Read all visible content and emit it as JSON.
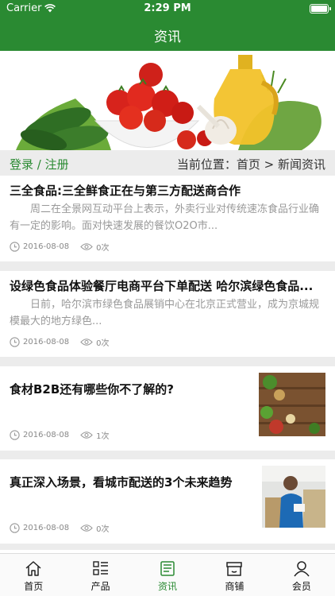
{
  "status_bar": {
    "carrier": "Carrier",
    "time": "2:29 PM"
  },
  "nav": {
    "title": "资讯"
  },
  "auth": {
    "login": "登录",
    "slash": " / ",
    "register": "注册"
  },
  "breadcrumb": {
    "prefix": "当前位置：",
    "home": "首页",
    "sep": " > ",
    "current": "新闻资讯"
  },
  "articles": [
    {
      "title": "三全食品:三全鲜食正在与第三方配送商合作",
      "summary": "周二在全景网互动平台上表示，外卖行业对传统速冻食品行业确有一定的影响。面对快速发展的餐饮O2O市...",
      "date": "2016-08-08",
      "views": "0次"
    },
    {
      "title": "设绿色食品体验餐厅电商平台下单配送 哈尔滨绿色食品...",
      "summary": "日前，哈尔滨市绿色食品展销中心在北京正式营业，成为京城规模最大的地方绿色...",
      "date": "2016-08-08",
      "views": "0次"
    },
    {
      "title": "食材B2B还有哪些你不了解的?",
      "date": "2016-08-08",
      "views": "1次"
    },
    {
      "title": "真正深入场景，看城市配送的3个未来趋势",
      "date": "2016-08-08",
      "views": "0次"
    }
  ],
  "tabbar": [
    {
      "label": "首页",
      "icon": "home-icon"
    },
    {
      "label": "产品",
      "icon": "grid-list-icon"
    },
    {
      "label": "资讯",
      "icon": "news-icon",
      "active": true
    },
    {
      "label": "商铺",
      "icon": "store-icon"
    },
    {
      "label": "会员",
      "icon": "user-icon"
    }
  ],
  "colors": {
    "brand": "#2a8a32",
    "background": "#ececec"
  }
}
